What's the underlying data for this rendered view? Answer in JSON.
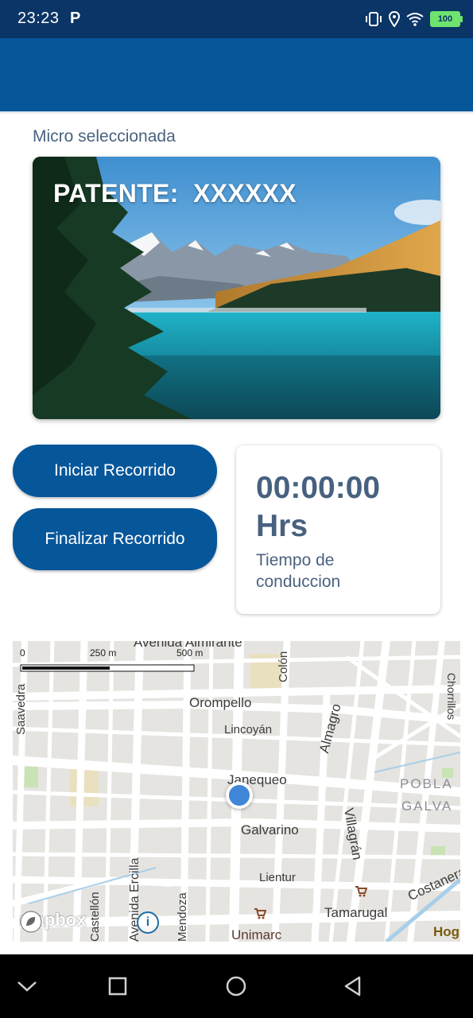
{
  "status_bar": {
    "time": "23:23",
    "notification_letter": "P",
    "battery": "100"
  },
  "app_bar": {
    "color": "#06569a"
  },
  "selected_bus": {
    "section_label": "Micro seleccionada",
    "plate_label": "PATENTE:",
    "plate_value": "XXXXXX"
  },
  "actions": {
    "start_label": "Iniciar Recorrido",
    "end_label": "Finalizar Recorrido"
  },
  "timer": {
    "value": "00:00:00",
    "unit": "Hrs",
    "caption": "Tiempo de conduccion"
  },
  "map": {
    "scale_labels": [
      "0",
      "250 m",
      "500 m"
    ],
    "streets": [
      "Avenida Almirante",
      "Orompello",
      "Colón",
      "Lincoyán",
      "Almagro",
      "Villagrán",
      "Janequeo",
      "Galvarino",
      "Lientur",
      "Tamarugal",
      "Costanera",
      "Saavedra",
      "Avenida Ercilla",
      "Castellón",
      "Mendoza",
      "Chorrillos"
    ],
    "places": [
      "POBLA",
      "GALVA",
      "Unimarc",
      "Hog"
    ],
    "attribution": "mapbox",
    "info_symbol": "i"
  },
  "nav_bar": {
    "buttons": [
      "chevron-down-icon",
      "square-icon",
      "circle-icon",
      "triangle-back-icon"
    ]
  },
  "colors": {
    "primary": "#06569a",
    "status_bar": "#0a3566",
    "text_secondary": "#4a6280",
    "location_dot": "#3f87d6"
  }
}
